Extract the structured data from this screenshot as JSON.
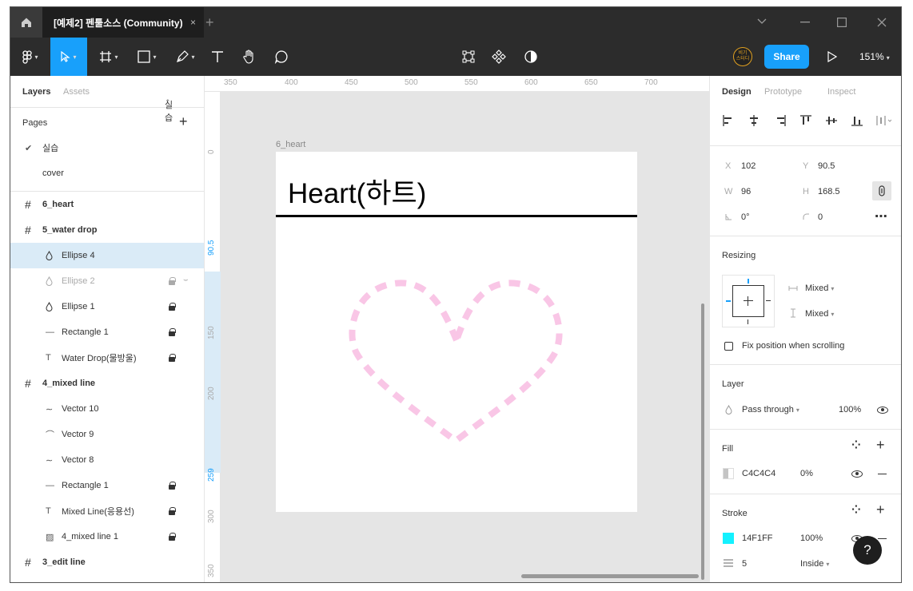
{
  "titlebar": {
    "tab_title": "[예제2] 펜툴소스 (Community)",
    "tab_close": "×",
    "new_tab": "+"
  },
  "toolbar": {
    "share_label": "Share",
    "zoom": "151%",
    "avatar_text": "비기\n스터디"
  },
  "left_panel": {
    "tabs": {
      "layers": "Layers",
      "assets": "Assets",
      "page_menu": "실습"
    },
    "pages_header": "Pages",
    "pages": [
      {
        "label": "실습",
        "checked": true
      },
      {
        "label": "cover",
        "checked": false
      }
    ],
    "layers": [
      {
        "label": "6_heart",
        "icon": "#",
        "level": 0
      },
      {
        "label": "5_water drop",
        "icon": "#",
        "level": 0
      },
      {
        "label": "Ellipse 4",
        "icon": "drop",
        "level": 1,
        "selected": true
      },
      {
        "label": "Ellipse 2",
        "icon": "drop",
        "level": 1,
        "locked": true,
        "hidden": true
      },
      {
        "label": "Ellipse 1",
        "icon": "drop",
        "level": 1,
        "locked": true
      },
      {
        "label": "Rectangle 1",
        "icon": "line",
        "level": 1,
        "locked": true
      },
      {
        "label": "Water Drop(물방울)",
        "icon": "text",
        "level": 1,
        "locked": true
      },
      {
        "label": "4_mixed line",
        "icon": "#",
        "level": 0
      },
      {
        "label": "Vector 10",
        "icon": "wave",
        "level": 1
      },
      {
        "label": "Vector 9",
        "icon": "arc",
        "level": 1
      },
      {
        "label": "Vector 8",
        "icon": "wave",
        "level": 1
      },
      {
        "label": "Rectangle 1",
        "icon": "line",
        "level": 1,
        "locked": true
      },
      {
        "label": "Mixed Line(응용선)",
        "icon": "text",
        "level": 1,
        "locked": true
      },
      {
        "label": "4_mixed line 1",
        "icon": "image",
        "level": 1,
        "locked": true
      },
      {
        "label": "3_edit line",
        "icon": "#",
        "level": 0
      }
    ]
  },
  "canvas": {
    "ruler_top": [
      "350",
      "400",
      "450",
      "500",
      "550",
      "600",
      "650",
      "700"
    ],
    "ruler_left": [
      {
        "label": "0",
        "highlight": false
      },
      {
        "label": "90.5",
        "highlight": true
      },
      {
        "label": "150",
        "highlight": false
      },
      {
        "label": "200",
        "highlight": false
      },
      {
        "label": "259",
        "highlight": true
      },
      {
        "label": "300",
        "highlight": false
      },
      {
        "label": "350",
        "highlight": false
      }
    ],
    "frame_label": "6_heart",
    "frame_title": "Heart(하트)",
    "heart_stroke_color": "#f9c6e6"
  },
  "right_panel": {
    "tabs": {
      "design": "Design",
      "prototype": "Prototype",
      "inspect": "Inspect"
    },
    "x_label": "X",
    "x": "102",
    "y_label": "Y",
    "y": "90.5",
    "w_label": "W",
    "w": "96",
    "h_label": "H",
    "h": "168.5",
    "rotation": "0°",
    "radius": "0",
    "resizing": {
      "title": "Resizing",
      "horizontal": "Mixed",
      "vertical": "Mixed",
      "fix_position": "Fix position when scrolling"
    },
    "layer": {
      "title": "Layer",
      "blend": "Pass through",
      "opacity": "100%"
    },
    "fill": {
      "title": "Fill",
      "hex": "C4C4C4",
      "opacity": "0%",
      "swatch": "#c4c4c4"
    },
    "stroke": {
      "title": "Stroke",
      "hex": "14F1FF",
      "opacity": "100%",
      "swatch": "#14f1ff",
      "weight": "5",
      "align": "Inside"
    },
    "help": "?"
  }
}
